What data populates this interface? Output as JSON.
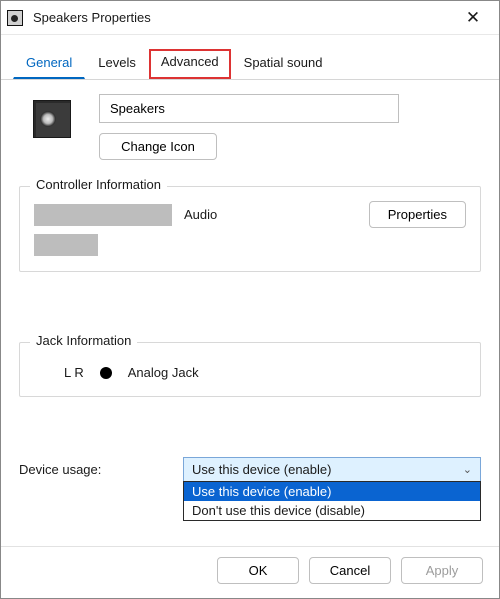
{
  "window": {
    "title": "Speakers Properties"
  },
  "tabs": {
    "general": "General",
    "levels": "Levels",
    "advanced": "Advanced",
    "spatial": "Spatial sound"
  },
  "general": {
    "device_name": "Speakers",
    "change_icon_label": "Change Icon"
  },
  "controller": {
    "title": "Controller Information",
    "suffix": "Audio",
    "properties_label": "Properties"
  },
  "jack": {
    "title": "Jack Information",
    "lr": "L R",
    "type": "Analog Jack"
  },
  "usage": {
    "label": "Device usage:",
    "selected": "Use this device (enable)",
    "options": [
      "Use this device (enable)",
      "Don't use this device (disable)"
    ]
  },
  "footer": {
    "ok": "OK",
    "cancel": "Cancel",
    "apply": "Apply"
  }
}
